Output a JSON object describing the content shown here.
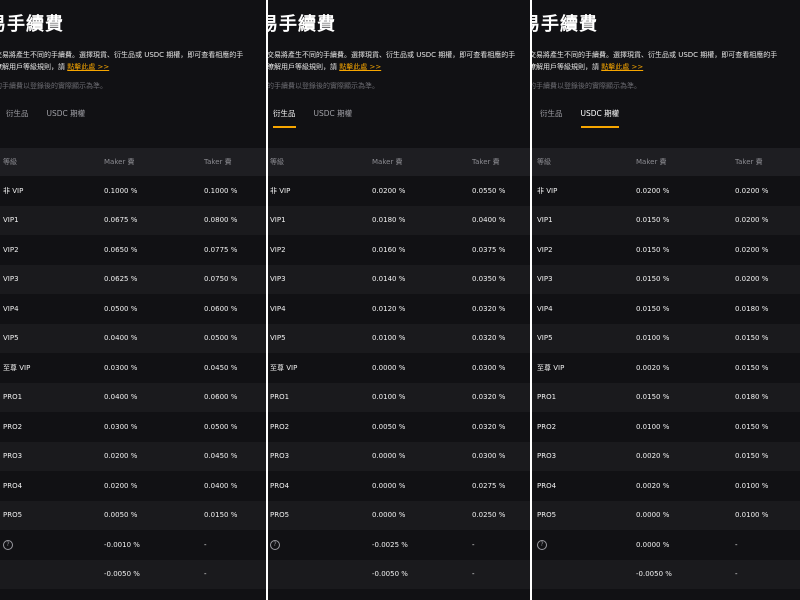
{
  "panels": [
    {
      "title": "易手續費",
      "desc_line1": "的交易將產生不同的手續費。選擇現貨、衍生品或 USDC 期權，即可查看相應的手",
      "desc_line2": "步瞭解用戶等級規則，請",
      "link": "點擊此處 >>",
      "note": "欲的手續費以登錄後的實際顯示為準。",
      "tabs": [
        {
          "label": "衍生品",
          "active": false
        },
        {
          "label": "USDC 期權",
          "active": false
        }
      ],
      "headers": [
        "等級",
        "Maker 費",
        "Taker 費"
      ],
      "rows": [
        {
          "level": "非 VIP",
          "maker": "0.1000 %",
          "taker": "0.1000 %"
        },
        {
          "level": "VIP1",
          "maker": "0.0675 %",
          "taker": "0.0800 %"
        },
        {
          "level": "VIP2",
          "maker": "0.0650 %",
          "taker": "0.0775 %"
        },
        {
          "level": "VIP3",
          "maker": "0.0625 %",
          "taker": "0.0750 %"
        },
        {
          "level": "VIP4",
          "maker": "0.0500 %",
          "taker": "0.0600 %"
        },
        {
          "level": "VIP5",
          "maker": "0.0400 %",
          "taker": "0.0500 %"
        },
        {
          "level": "至尊 VIP",
          "maker": "0.0300 %",
          "taker": "0.0450 %"
        },
        {
          "level": "PRO1",
          "maker": "0.0400 %",
          "taker": "0.0600 %"
        },
        {
          "level": "PRO2",
          "maker": "0.0300 %",
          "taker": "0.0500 %"
        },
        {
          "level": "PRO3",
          "maker": "0.0200 %",
          "taker": "0.0450 %"
        },
        {
          "level": "PRO4",
          "maker": "0.0200 %",
          "taker": "0.0400 %"
        },
        {
          "level": "PRO5",
          "maker": "0.0050 %",
          "taker": "0.0150 %"
        },
        {
          "level": "",
          "icon": true,
          "maker": "-0.0010 %",
          "taker": "-"
        },
        {
          "level": "",
          "maker": "-0.0050 %",
          "taker": "-"
        }
      ]
    },
    {
      "title": "易手續費",
      "desc_line1": "的交易將產生不同的手續費。選擇現貨、衍生品或 USDC 期權，即可查看相應的手",
      "desc_line2": "步瞭解用戶等級規則，請",
      "link": "點擊此處 >>",
      "note": "欲的手續費以登錄後的實際顯示為準。",
      "tabs": [
        {
          "label": "衍生品",
          "active": true
        },
        {
          "label": "USDC 期權",
          "active": false
        }
      ],
      "headers": [
        "等級",
        "Maker 費",
        "Taker 費"
      ],
      "rows": [
        {
          "level": "非 VIP",
          "maker": "0.0200 %",
          "taker": "0.0550 %"
        },
        {
          "level": "VIP1",
          "maker": "0.0180 %",
          "taker": "0.0400 %"
        },
        {
          "level": "VIP2",
          "maker": "0.0160 %",
          "taker": "0.0375 %"
        },
        {
          "level": "VIP3",
          "maker": "0.0140 %",
          "taker": "0.0350 %"
        },
        {
          "level": "VIP4",
          "maker": "0.0120 %",
          "taker": "0.0320 %"
        },
        {
          "level": "VIP5",
          "maker": "0.0100 %",
          "taker": "0.0320 %"
        },
        {
          "level": "至尊 VIP",
          "maker": "0.0000 %",
          "taker": "0.0300 %"
        },
        {
          "level": "PRO1",
          "maker": "0.0100 %",
          "taker": "0.0320 %"
        },
        {
          "level": "PRO2",
          "maker": "0.0050 %",
          "taker": "0.0320 %"
        },
        {
          "level": "PRO3",
          "maker": "0.0000 %",
          "taker": "0.0300 %"
        },
        {
          "level": "PRO4",
          "maker": "0.0000 %",
          "taker": "0.0275 %"
        },
        {
          "level": "PRO5",
          "maker": "0.0000 %",
          "taker": "0.0250 %"
        },
        {
          "level": "",
          "icon": true,
          "maker": "-0.0025 %",
          "taker": "-"
        },
        {
          "level": "",
          "maker": "-0.0050 %",
          "taker": "-"
        }
      ]
    },
    {
      "title": "易手續費",
      "desc_line1": "的交易將產生不同的手續費。選擇現貨、衍生品或 USDC 期權，即可查看相應的手",
      "desc_line2": "步瞭解用戶等級規則，請",
      "link": "點擊此處 >>",
      "note": "欲的手續費以登錄後的實際顯示為準。",
      "tabs": [
        {
          "label": "衍生品",
          "active": false
        },
        {
          "label": "USDC 期權",
          "active": true
        }
      ],
      "headers": [
        "等級",
        "Maker 費",
        "Taker 費"
      ],
      "rows": [
        {
          "level": "非 VIP",
          "maker": "0.0200 %",
          "taker": "0.0200 %"
        },
        {
          "level": "VIP1",
          "maker": "0.0150 %",
          "taker": "0.0200 %"
        },
        {
          "level": "VIP2",
          "maker": "0.0150 %",
          "taker": "0.0200 %"
        },
        {
          "level": "VIP3",
          "maker": "0.0150 %",
          "taker": "0.0200 %"
        },
        {
          "level": "VIP4",
          "maker": "0.0150 %",
          "taker": "0.0180 %"
        },
        {
          "level": "VIP5",
          "maker": "0.0100 %",
          "taker": "0.0150 %"
        },
        {
          "level": "至尊 VIP",
          "maker": "0.0020 %",
          "taker": "0.0150 %"
        },
        {
          "level": "PRO1",
          "maker": "0.0150 %",
          "taker": "0.0180 %"
        },
        {
          "level": "PRO2",
          "maker": "0.0100 %",
          "taker": "0.0150 %"
        },
        {
          "level": "PRO3",
          "maker": "0.0020 %",
          "taker": "0.0150 %"
        },
        {
          "level": "PRO4",
          "maker": "0.0020 %",
          "taker": "0.0100 %"
        },
        {
          "level": "PRO5",
          "maker": "0.0000 %",
          "taker": "0.0100 %"
        },
        {
          "level": "",
          "icon": true,
          "maker": "0.0000 %",
          "taker": "-"
        },
        {
          "level": "",
          "maker": "-0.0050 %",
          "taker": "-"
        }
      ]
    }
  ]
}
